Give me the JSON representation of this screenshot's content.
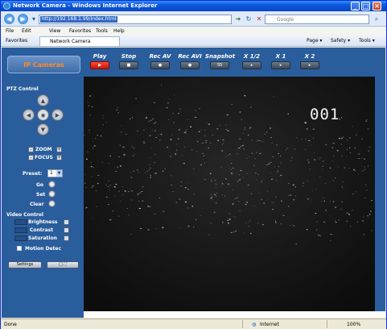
{
  "window": {
    "title": "Network Camera - Windows Internet Explorer",
    "minimize": "_",
    "maximize": "□",
    "close": "×"
  },
  "address": {
    "url": "http://192.168.1.99/index.html",
    "search_placeholder": "Google"
  },
  "menu": [
    "File",
    "Edit",
    "View",
    "Favorites",
    "Tools",
    "Help"
  ],
  "tabs": {
    "favorites_label": "Favorites",
    "active_tab": "Network Camera",
    "right_items": [
      "Page ▾",
      "Safety ▾",
      "Tools ▾"
    ]
  },
  "logo": {
    "text": "IP Cameras",
    "color": "#ff8a2a"
  },
  "toolbar": [
    {
      "label": "Play",
      "button": "▶",
      "active": true
    },
    {
      "label": "Stop",
      "button": "■",
      "active": false
    },
    {
      "label": "Rec AV",
      "button": "●",
      "active": false
    },
    {
      "label": "Rec AVI",
      "button": "●",
      "active": false
    },
    {
      "label": "Snapshot",
      "button": "SS",
      "active": false
    },
    {
      "label": "X 1/2",
      "button": "▸",
      "active": false
    },
    {
      "label": "X 1",
      "button": "▸",
      "active": false
    },
    {
      "label": "X 2",
      "button": "▸",
      "active": false
    }
  ],
  "ptz": {
    "title": "PTZ Control",
    "zoom": "ZOOM",
    "focus": "FOCUS",
    "minus": "-",
    "plus": "+",
    "up": "▲",
    "down": "▼",
    "left": "◀",
    "right": "▶",
    "home": "◉"
  },
  "preset": {
    "label": "Preset:",
    "value": "1",
    "go": "Go",
    "set": "Set",
    "clear": "Clear"
  },
  "video_control": {
    "title": "Video Control",
    "brightness": "Brightness",
    "contrast": "Contrast",
    "saturation": "Saturation",
    "motion": "Motion Detec"
  },
  "bottom_buttons": {
    "settings": "Settings",
    "fullscreen": "□ ⛶"
  },
  "video": {
    "osd_text": "001"
  },
  "status": {
    "left": "Done",
    "zone": "Internet",
    "zoom": "100%"
  },
  "colors": {
    "panel": "#2a5d9c",
    "play_active": "#e0231a"
  }
}
